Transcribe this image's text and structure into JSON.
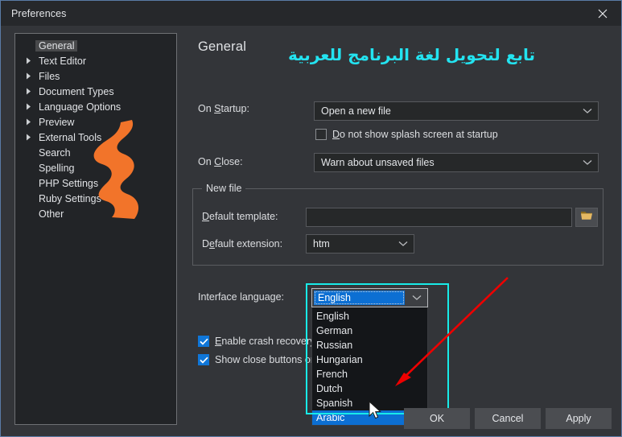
{
  "window": {
    "title": "Preferences",
    "close_icon": "close-icon"
  },
  "sidebar": {
    "items": [
      {
        "label": "General",
        "expandable": false,
        "selected": true
      },
      {
        "label": "Text Editor",
        "expandable": true,
        "selected": false
      },
      {
        "label": "Files",
        "expandable": true,
        "selected": false
      },
      {
        "label": "Document Types",
        "expandable": true,
        "selected": false
      },
      {
        "label": "Language Options",
        "expandable": true,
        "selected": false
      },
      {
        "label": "Preview",
        "expandable": true,
        "selected": false
      },
      {
        "label": "External Tools",
        "expandable": true,
        "selected": false
      },
      {
        "label": "Search",
        "expandable": false,
        "selected": false
      },
      {
        "label": "Spelling",
        "expandable": false,
        "selected": false
      },
      {
        "label": "PHP Settings",
        "expandable": false,
        "selected": false
      },
      {
        "label": "Ruby Settings",
        "expandable": false,
        "selected": false
      },
      {
        "label": "Other",
        "expandable": false,
        "selected": false
      }
    ]
  },
  "main": {
    "page_title": "General",
    "annotation_text": "تابع لتحويل لغة البرنامج للعربية",
    "annotation_color": "#23e3f0",
    "on_startup": {
      "label_prefix": "On ",
      "label_accel": "S",
      "label_suffix": "tartup:",
      "value": "Open a new file"
    },
    "splash_checkbox": {
      "label_prefix": "",
      "label_accel": "D",
      "label_suffix": "o not show splash screen at startup",
      "checked": false
    },
    "on_close": {
      "label_prefix": "On ",
      "label_accel": "C",
      "label_suffix": "lose:",
      "value": "Warn about unsaved files"
    },
    "new_file_group": {
      "title": "New file",
      "default_template": {
        "label_prefix": "",
        "label_accel": "D",
        "label_suffix": "efault template:",
        "value": "",
        "browse_icon": "folder-open-icon"
      },
      "default_extension": {
        "label_prefix": "D",
        "label_accel": "e",
        "label_suffix": "fault extension:",
        "value": "htm"
      }
    },
    "interface_language": {
      "label": "Interface language:",
      "selected": "Arabic",
      "combo_display": "English",
      "options": [
        "English",
        "German",
        "Russian",
        "Hungarian",
        "French",
        "Dutch",
        "Spanish",
        "Arabic"
      ],
      "highlight_color": "#18ebe8"
    },
    "crash_recovery": {
      "label_prefix": "",
      "label_accel": "E",
      "label_suffix": "nable crash recovery",
      "checked": true
    },
    "close_buttons": {
      "label": "Show close buttons on t",
      "checked": true
    }
  },
  "footer": {
    "ok": "OK",
    "cancel": "Cancel",
    "apply": "Apply"
  }
}
